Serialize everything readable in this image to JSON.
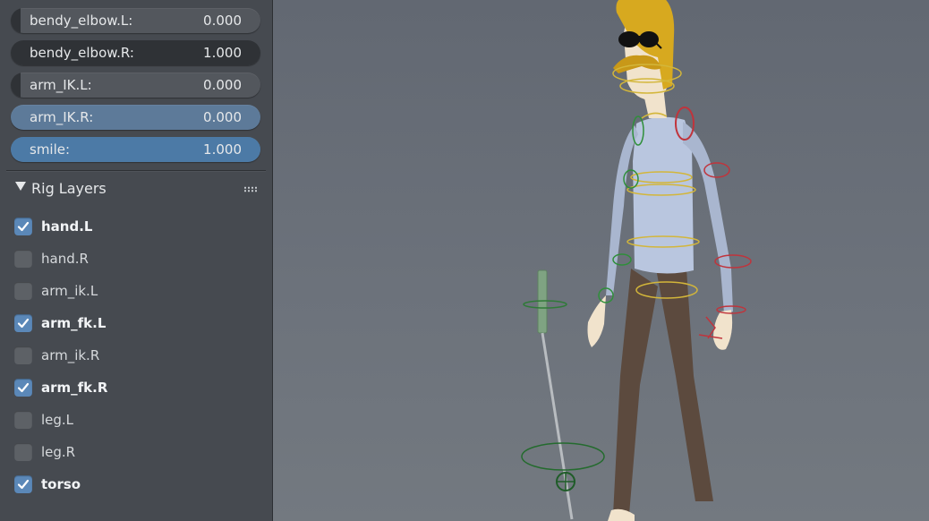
{
  "sliders": [
    {
      "label": "bendy_elbow.L:",
      "value": "0.000",
      "fill": 0.0,
      "state": "normal"
    },
    {
      "label": "bendy_elbow.R:",
      "value": "1.000",
      "fill": 1.0,
      "state": "normal"
    },
    {
      "label": "arm_IK.L:",
      "value": "0.000",
      "fill": 0.0,
      "state": "normal"
    },
    {
      "label": "arm_IK.R:",
      "value": "0.000",
      "fill": 0.0,
      "state": "hover"
    },
    {
      "label": "smile:",
      "value": "1.000",
      "fill": 1.0,
      "state": "accent"
    }
  ],
  "rig_layers": {
    "title": "Rig Layers",
    "items": [
      {
        "label": "hand.L",
        "checked": true
      },
      {
        "label": "hand.R",
        "checked": false
      },
      {
        "label": "arm_ik.L",
        "checked": false
      },
      {
        "label": "arm_fk.L",
        "checked": true
      },
      {
        "label": "arm_ik.R",
        "checked": false
      },
      {
        "label": "arm_fk.R",
        "checked": true
      },
      {
        "label": "leg.L",
        "checked": false
      },
      {
        "label": "leg.R",
        "checked": false
      },
      {
        "label": "torso",
        "checked": true
      }
    ]
  },
  "colors": {
    "accent": "#4c7aa6",
    "checkbox_on": "#5b88b8",
    "viewport_bg": "#6a7079",
    "hair": "#d7a91f",
    "shirt": "#b9c6df",
    "pants": "#5c4a3e",
    "skin": "#f1e3cc",
    "control_red": "#c0343c",
    "control_green": "#2f8f3a",
    "control_yellow": "#d3b63a"
  }
}
